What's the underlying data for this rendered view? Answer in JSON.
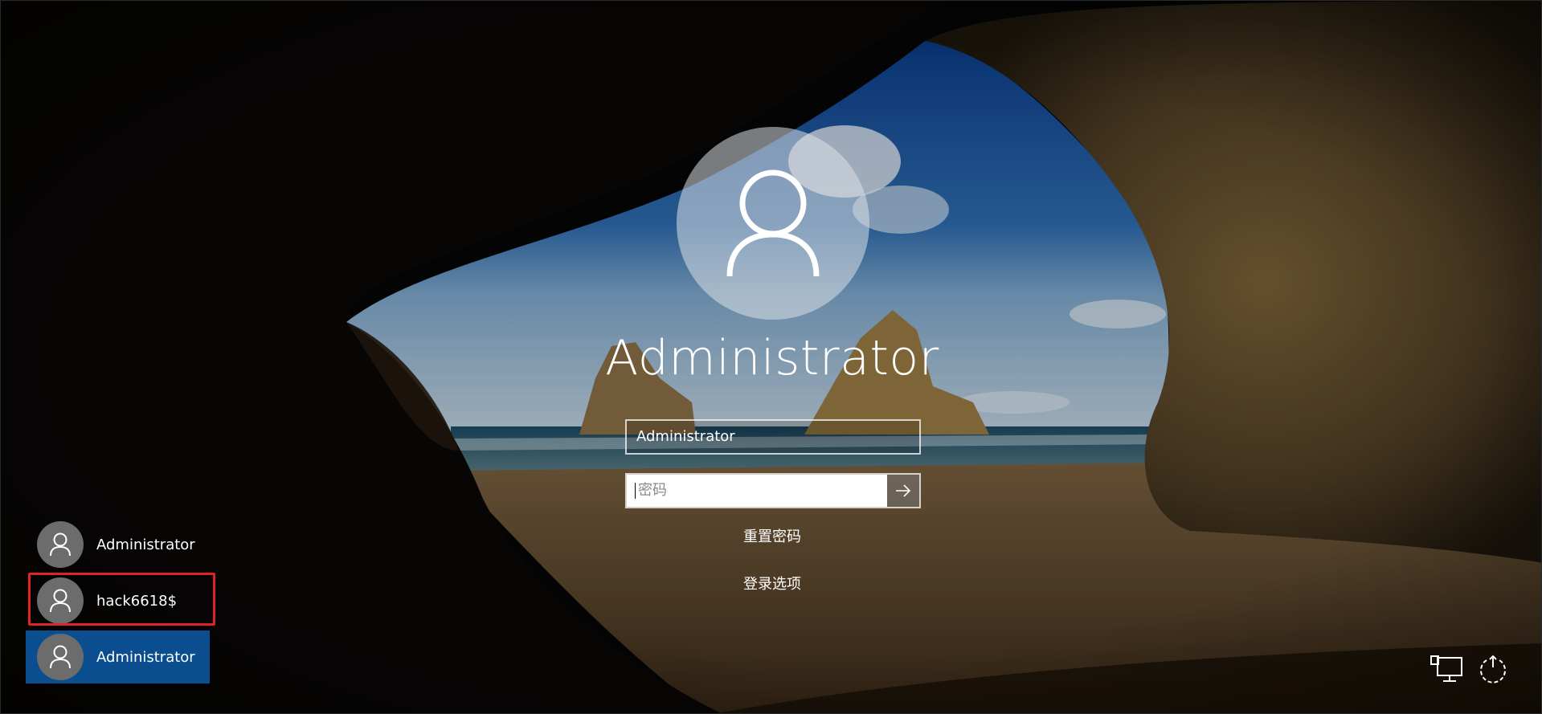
{
  "current_user": {
    "display_name": "Administrator"
  },
  "login_form": {
    "username_value": "Administrator",
    "password_placeholder": "密码",
    "submit_icon": "arrow-right-icon",
    "reset_password_label": "重置密码",
    "signin_options_label": "登录选项"
  },
  "user_list": [
    {
      "name": "Administrator",
      "icon": "user-icon",
      "selected": false,
      "highlighted": false
    },
    {
      "name": "hack6618$",
      "icon": "user-icon",
      "selected": false,
      "highlighted": true
    },
    {
      "name": "Administrator",
      "icon": "user-icon",
      "selected": true,
      "highlighted": false
    }
  ],
  "system_buttons": {
    "network_icon": "network-icon",
    "power_icon": "power-icon"
  },
  "colors": {
    "selected_tile": "#0a4e90",
    "highlight_border": "#e02424",
    "avatar_gray": "#6c6c6c"
  }
}
